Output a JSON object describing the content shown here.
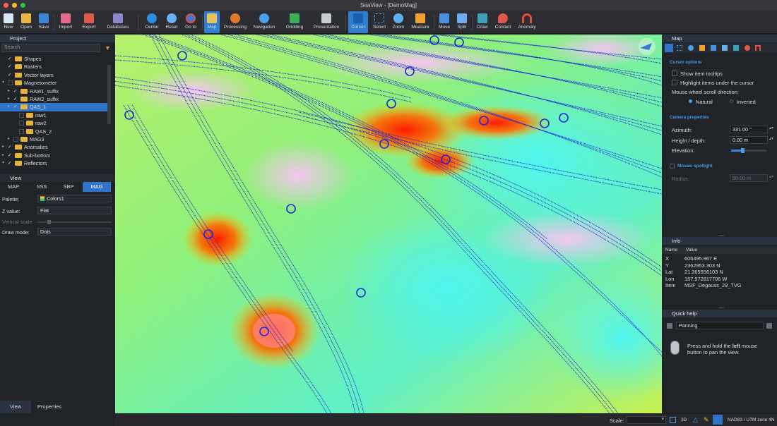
{
  "window": {
    "title": "SeaView - [DemoMag]"
  },
  "toolbar": {
    "new": "New",
    "open": "Open",
    "save": "Save",
    "import": "Import",
    "export": "Export",
    "databases": "Databases",
    "center": "Center",
    "reset": "Reset",
    "goto": "Go to",
    "map": "Map",
    "processing": "Processing",
    "navigation": "Navigation",
    "gridding": "Gridding",
    "presentation": "Presentation",
    "cursor": "Cursor",
    "select": "Select",
    "zoom": "Zoom",
    "measure": "Measure",
    "move": "Move",
    "split": "Split",
    "draw": "Draw",
    "contact": "Contact",
    "anomaly": "Anomaly"
  },
  "project": {
    "title": "Project",
    "search_placeholder": "Search",
    "items": [
      {
        "label": "Shapes",
        "checked": true,
        "expander": ""
      },
      {
        "label": "Rasters",
        "checked": true,
        "expander": ""
      },
      {
        "label": "Vector layers",
        "checked": true,
        "expander": ""
      },
      {
        "label": "Magnetometer",
        "checked": false,
        "expander": "▾"
      },
      {
        "label": "RAW1_suffix",
        "checked": true,
        "expander": "▸"
      },
      {
        "label": "RAW2_suffix",
        "checked": true,
        "expander": "▸"
      },
      {
        "label": "QAS_1",
        "checked": true,
        "expander": "▸"
      },
      {
        "label": "raw1",
        "checked": false,
        "expander": ""
      },
      {
        "label": "raw2",
        "checked": false,
        "expander": ""
      },
      {
        "label": "QAS_2",
        "checked": false,
        "expander": ""
      },
      {
        "label": "MAG3",
        "checked": false,
        "expander": "▸"
      },
      {
        "label": "Anomalies",
        "checked": true,
        "expander": "▸"
      },
      {
        "label": "Sub-bottom",
        "checked": true,
        "expander": "▸"
      },
      {
        "label": "Reflectors",
        "checked": true,
        "expander": "▾"
      }
    ]
  },
  "view": {
    "title": "View",
    "tabs": [
      "MAP",
      "SSS",
      "SBP",
      "MAG"
    ],
    "palette_label": "Palette:",
    "palette_value": "Colors1",
    "zvalue_label": "Z value:",
    "zvalue_value": "Flat",
    "vscale_label": "Vertical scale:",
    "drawmode_label": "Draw mode:",
    "drawmode_value": "Dots",
    "bottom_tabs": [
      "View",
      "Properties"
    ]
  },
  "map_panel": {
    "title": "Map",
    "cursor_options": "Cursor options",
    "show_tooltips": "Show item tooltips",
    "highlight": "Highlight items under the cursor",
    "wheel_label": "Mouse wheel scroll direction:",
    "natural": "Natural",
    "inverted": "Inverted",
    "camera": "Camera properties",
    "azimuth_label": "Azimuth:",
    "azimuth_value": "331.00 °",
    "height_label": "Height / depth:",
    "height_value": "0.00 m",
    "elevation_label": "Elevation:",
    "spotlight": "Mosaic spotlight",
    "radius_label": "Radius:",
    "radius_value": "50.00 m"
  },
  "info": {
    "title": "Info",
    "col_name": "Name",
    "col_value": "Value",
    "rows": [
      {
        "name": "X",
        "value": "606495.967 E"
      },
      {
        "name": "Y",
        "value": "2362953.303 N"
      },
      {
        "name": "Lat",
        "value": "21.365556103 N"
      },
      {
        "name": "Lon",
        "value": "157.972817706 W"
      },
      {
        "name": "Item",
        "value": "MSF_Degauss_29_TVG"
      }
    ]
  },
  "quick_help": {
    "title": "Quick help",
    "mode": "Panning",
    "text_1": "Press and hold the ",
    "text_bold": "left",
    "text_2": " mouse",
    "text_3": "button to pan the view."
  },
  "status": {
    "scale_label": "Scale:",
    "btn_3d": "3D",
    "crs": "NAD83 / UTM zone 4N"
  }
}
